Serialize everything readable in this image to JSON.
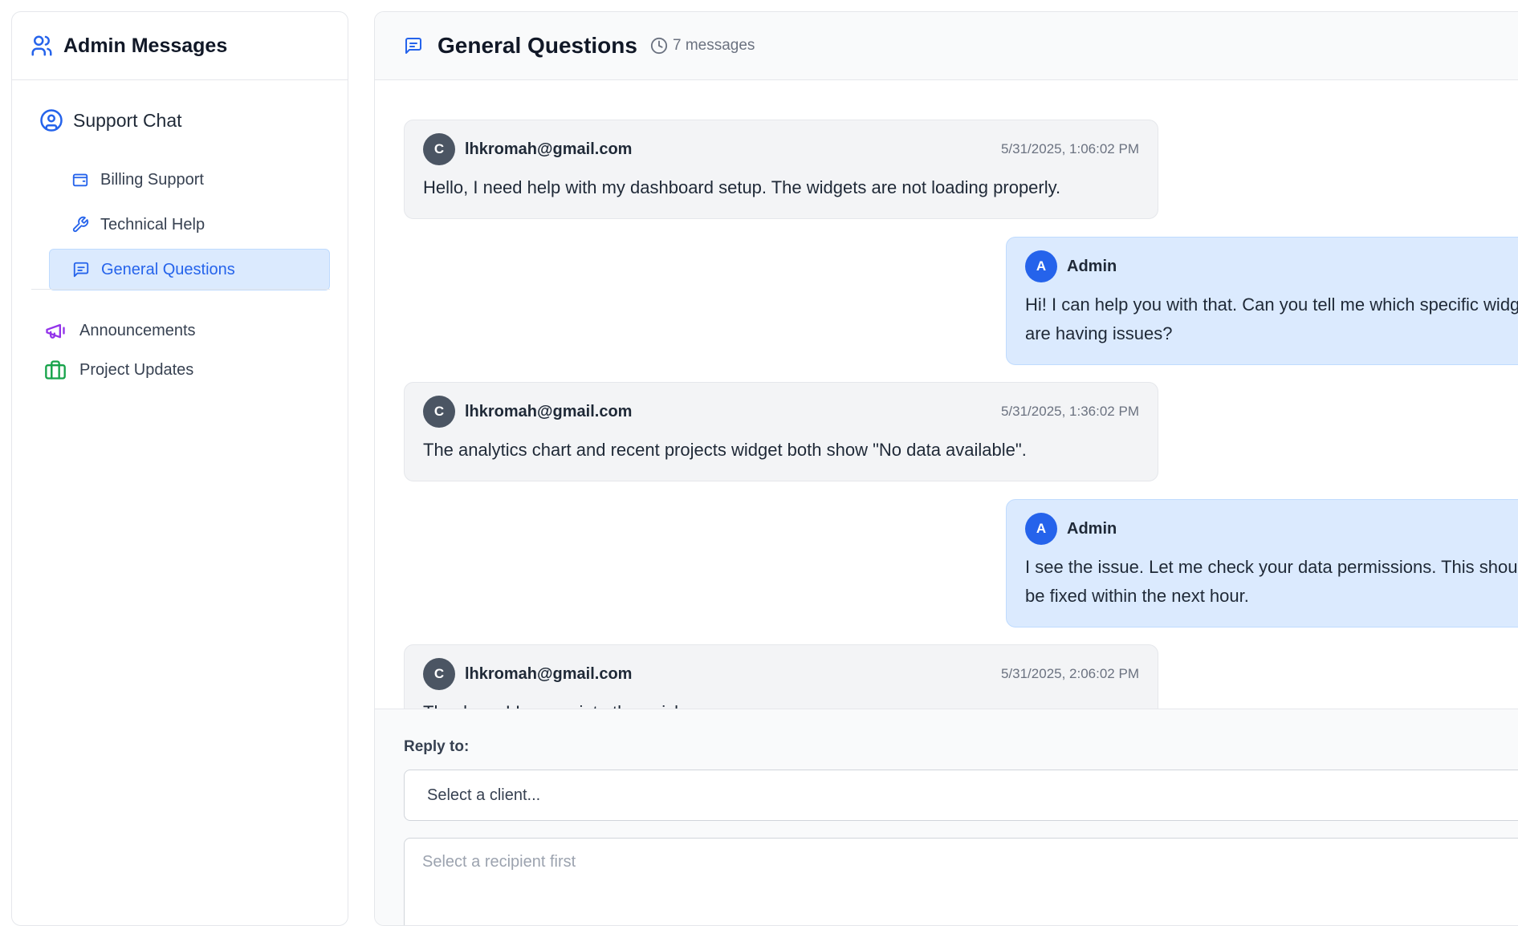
{
  "sidebar": {
    "title": "Admin Messages",
    "section": "Support Chat",
    "subitems": [
      {
        "label": "Billing Support",
        "icon": "wallet-icon"
      },
      {
        "label": "Technical Help",
        "icon": "wrench-icon"
      },
      {
        "label": "General Questions",
        "icon": "message-square-icon",
        "active": true
      }
    ],
    "items": [
      {
        "label": "Announcements",
        "icon": "megaphone-icon"
      },
      {
        "label": "Project Updates",
        "icon": "briefcase-icon"
      }
    ]
  },
  "conversation": {
    "title": "General Questions",
    "count": "7 messages"
  },
  "messages": [
    {
      "role": "client",
      "avatar": "C",
      "sender": "lhkromah@gmail.com",
      "time": "5/31/2025, 1:06:02 PM",
      "text": "Hello, I need help with my dashboard setup. The widgets are not loading properly."
    },
    {
      "role": "admin",
      "avatar": "A",
      "sender": "Admin",
      "time": "",
      "text": "Hi! I can help you with that. Can you tell me which specific widgets are having issues?"
    },
    {
      "role": "client",
      "avatar": "C",
      "sender": "lhkromah@gmail.com",
      "time": "5/31/2025, 1:36:02 PM",
      "text": "The analytics chart and recent projects widget both show \"No data available\"."
    },
    {
      "role": "admin",
      "avatar": "A",
      "sender": "Admin",
      "time": "",
      "text": "I see the issue. Let me check your data permissions. This should be fixed within the next hour."
    },
    {
      "role": "client",
      "avatar": "C",
      "sender": "lhkromah@gmail.com",
      "time": "5/31/2025, 2:06:02 PM",
      "text": "Thank you! I appreciate the quick response."
    }
  ],
  "composer": {
    "reply_label": "Reply to:",
    "select_placeholder": "Select a client...",
    "textarea_placeholder": "Select a recipient first"
  },
  "colors": {
    "accent": "#2563eb",
    "active_bg": "#dbeafe",
    "megaphone": "#9333ea",
    "briefcase": "#16a34a"
  }
}
